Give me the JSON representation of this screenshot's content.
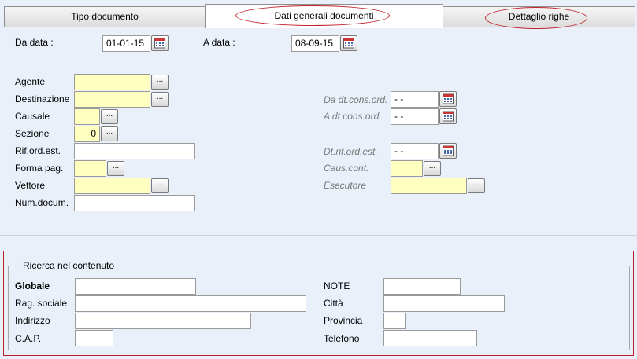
{
  "tabs": [
    {
      "label": "Tipo documento",
      "active": false
    },
    {
      "label": "Dati generali documenti",
      "active": true
    },
    {
      "label": "Dettaglio righe",
      "active": false
    }
  ],
  "dates": {
    "from_label": "Da data :",
    "from_value": "01-01-15",
    "to_label": "A data :",
    "to_value": "08-09-15"
  },
  "left_fields": {
    "agente": {
      "label": "Agente",
      "value": ""
    },
    "destinazione": {
      "label": "Destinazione",
      "value": ""
    },
    "causale": {
      "label": "Causale",
      "value": ""
    },
    "sezione": {
      "label": "Sezione",
      "value": "0"
    },
    "rif_ord_est": {
      "label": "Rif.ord.est.",
      "value": ""
    },
    "forma_pag": {
      "label": "Forma pag.",
      "value": ""
    },
    "vettore": {
      "label": "Vettore",
      "value": ""
    },
    "num_docum": {
      "label": "Num.docum.",
      "value": ""
    }
  },
  "right_fields": {
    "da_dt_cons_ord": {
      "label": "Da dt.cons.ord.",
      "value": "- -"
    },
    "a_dt_cons_ord": {
      "label": "A dt cons.ord.",
      "value": "- -"
    },
    "dt_rif_ord_est": {
      "label": "Dt.rif.ord.est.",
      "value": "- -"
    },
    "caus_cont": {
      "label": "Caus.cont.",
      "value": ""
    },
    "esecutore": {
      "label": "Esecutore",
      "value": ""
    }
  },
  "search": {
    "title": "Ricerca nel contenuto",
    "globale": {
      "label": "Globale",
      "value": ""
    },
    "rag_sociale": {
      "label": "Rag. sociale",
      "value": ""
    },
    "indirizzo": {
      "label": "Indirizzo",
      "value": ""
    },
    "cap": {
      "label": "C.A.P.",
      "value": ""
    },
    "note": {
      "label": "NOTE",
      "value": ""
    },
    "citta": {
      "label": "Città",
      "value": ""
    },
    "provincia": {
      "label": "Provincia",
      "value": ""
    },
    "telefono": {
      "label": "Telefono",
      "value": ""
    }
  },
  "lookup_button_label": "...",
  "colors": {
    "highlight_annotation": "#c0202a",
    "required_field": "#ffffc0",
    "background": "#e9f0f9"
  }
}
